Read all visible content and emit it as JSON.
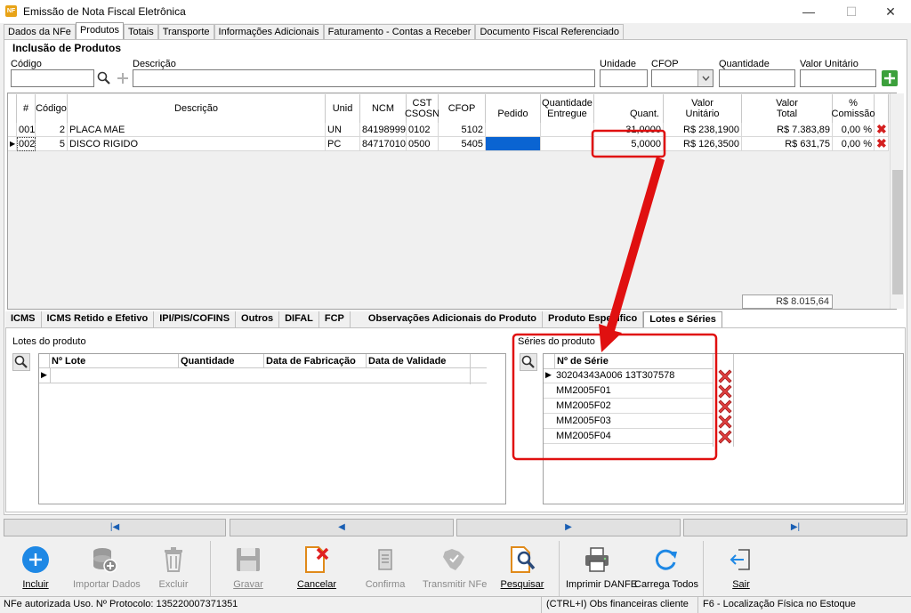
{
  "window": {
    "title": "Emissão de Nota Fiscal Eletrônica",
    "icon_text": "NF",
    "minimize": "—",
    "maximize": "☐",
    "close": "✕"
  },
  "tabs": [
    "Dados da NFe",
    "Produtos",
    "Totais",
    "Transporte",
    "Informações Adicionais",
    "Faturamento - Contas a Receber",
    "Documento Fiscal Referenciado"
  ],
  "inclusao": {
    "title": "Inclusão de Produtos",
    "codigo_label": "Código",
    "descricao_label": "Descrição",
    "unidade_label": "Unidade",
    "cfop_label": "CFOP",
    "quantidade_label": "Quantidade",
    "valor_unitario_label": "Valor Unitário",
    "codigo_value": "",
    "descricao_value": "",
    "unidade_value": "",
    "cfop_value": "",
    "quantidade_value": "",
    "valor_unitario_value": ""
  },
  "grid": {
    "headers": {
      "num": "#",
      "codigo": "Código",
      "descricao": "Descrição",
      "unid": "Unid",
      "ncm": "NCM",
      "cst": "CST\nCSOSN",
      "cfop": "CFOP",
      "pedido": "Pedido",
      "qtd_entregue": "Quantidade\nEntregue",
      "quant": "Quant.",
      "valor_unitario": "Valor\nUnitário",
      "valor_total": "Valor\nTotal",
      "comissao": "%\nComissão"
    },
    "rows": [
      {
        "num": "001",
        "codigo": "2",
        "descricao": "PLACA MAE",
        "unid": "UN",
        "ncm": "84198999",
        "cst": "0102",
        "cfop": "5102",
        "pedido": "",
        "qtd_entregue": "",
        "quant": "31,0000",
        "valor_unitario": "R$ 238,1900",
        "valor_total": "R$ 7.383,89",
        "comissao": "0,00 %"
      },
      {
        "num": "002",
        "codigo": "5",
        "descricao": "DISCO RIGIDO",
        "unid": "PC",
        "ncm": "84717010",
        "cst": "0500",
        "cfop": "5405",
        "pedido": "",
        "qtd_entregue": "",
        "quant": "5,0000",
        "valor_unitario": "R$ 126,3500",
        "valor_total": "R$ 631,75",
        "comissao": "0,00 %"
      }
    ],
    "total": "R$ 8.015,64"
  },
  "bottom_tabs": [
    "ICMS",
    "ICMS Retido e Efetivo",
    "IPI/PIS/COFINS",
    "Outros",
    "DIFAL",
    "FCP",
    "Observações Adicionais do Produto",
    "Produto Específico",
    "Lotes e Séries"
  ],
  "lotes": {
    "title": "Lotes do produto",
    "headers": [
      "Nº Lote",
      "Quantidade",
      "Data de Fabricação",
      "Data de Validade"
    ]
  },
  "series": {
    "title": "Séries do produto",
    "header": "Nº de Série",
    "items": [
      "30204343A006 13T307578",
      "MM2005F01",
      "MM2005F02",
      "MM2005F03",
      "MM2005F04"
    ]
  },
  "nav": {
    "first": "|◀",
    "prev": "◀",
    "next": "▶",
    "last": "▶|"
  },
  "toolbar": {
    "incluir": "Incluir",
    "importar": "Importar Dados",
    "excluir": "Excluir",
    "gravar": "Gravar",
    "cancelar": "Cancelar",
    "confirma": "Confirma",
    "transmitir": "Transmitir NFe",
    "pesquisar": "Pesquisar",
    "imprimir": "Imprimir DANFE",
    "carrega": "Carrega Todos",
    "sair": "Sair"
  },
  "status": {
    "left": "NFe autorizada Uso. Nº Protocolo: 135220007371351",
    "middle": "(CTRL+I) Obs financeiras cliente",
    "right": "F6 - Localização Física no Estoque"
  },
  "colors": {
    "annotation_red": "#e01010",
    "accent_blue": "#1e88e5",
    "selected_cell": "#0a64d2"
  }
}
